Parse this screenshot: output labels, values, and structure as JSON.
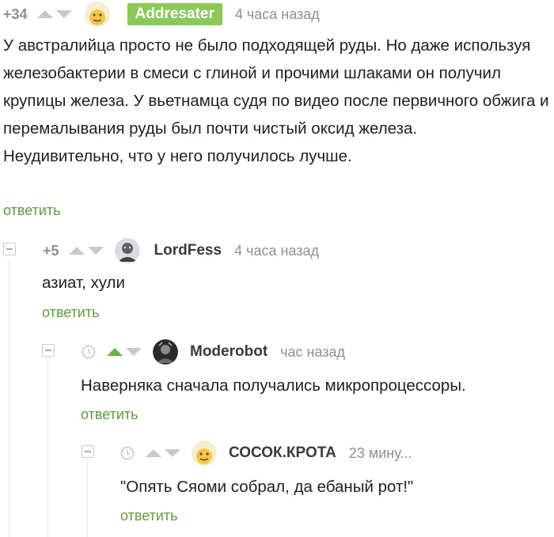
{
  "comments": [
    {
      "rating": "+34",
      "username": "Addresater",
      "time": "4 часа назад",
      "text": "У австралийца просто не было подходящей руды. Но даже используя железобактерии в смеси с глиной и прочими шлаками он получил крупицы железа. У вьетнамца судя по видео после первичного обжига и перемалывания руды был почти чистый оксид железа.",
      "text2": "Неудивительно, что у него получилось лучше.",
      "reply": "ответить"
    },
    {
      "rating": "+5",
      "username": "LordFess",
      "time": "4 часа назад",
      "text": "азиат, хули",
      "reply": "ответить"
    },
    {
      "username": "Moderobot",
      "time": "час назад",
      "text": "Наверняка сначала получались микропроцессоры.",
      "reply": "ответить"
    },
    {
      "username": "СОСОК.КРОТА",
      "time": "23 мину...",
      "text": "\"Опять Сяоми собрал, да ебаный рот!\"",
      "reply": "ответить"
    }
  ],
  "colors": {
    "accent_green": "#5d9e3a",
    "badge_green": "#8ac858",
    "upvote_active": "#67b34a",
    "muted": "#8f8f8f"
  },
  "icons": [
    "arrow-up-icon",
    "arrow-down-icon",
    "clock-icon",
    "collapse-icon",
    "avatar"
  ]
}
